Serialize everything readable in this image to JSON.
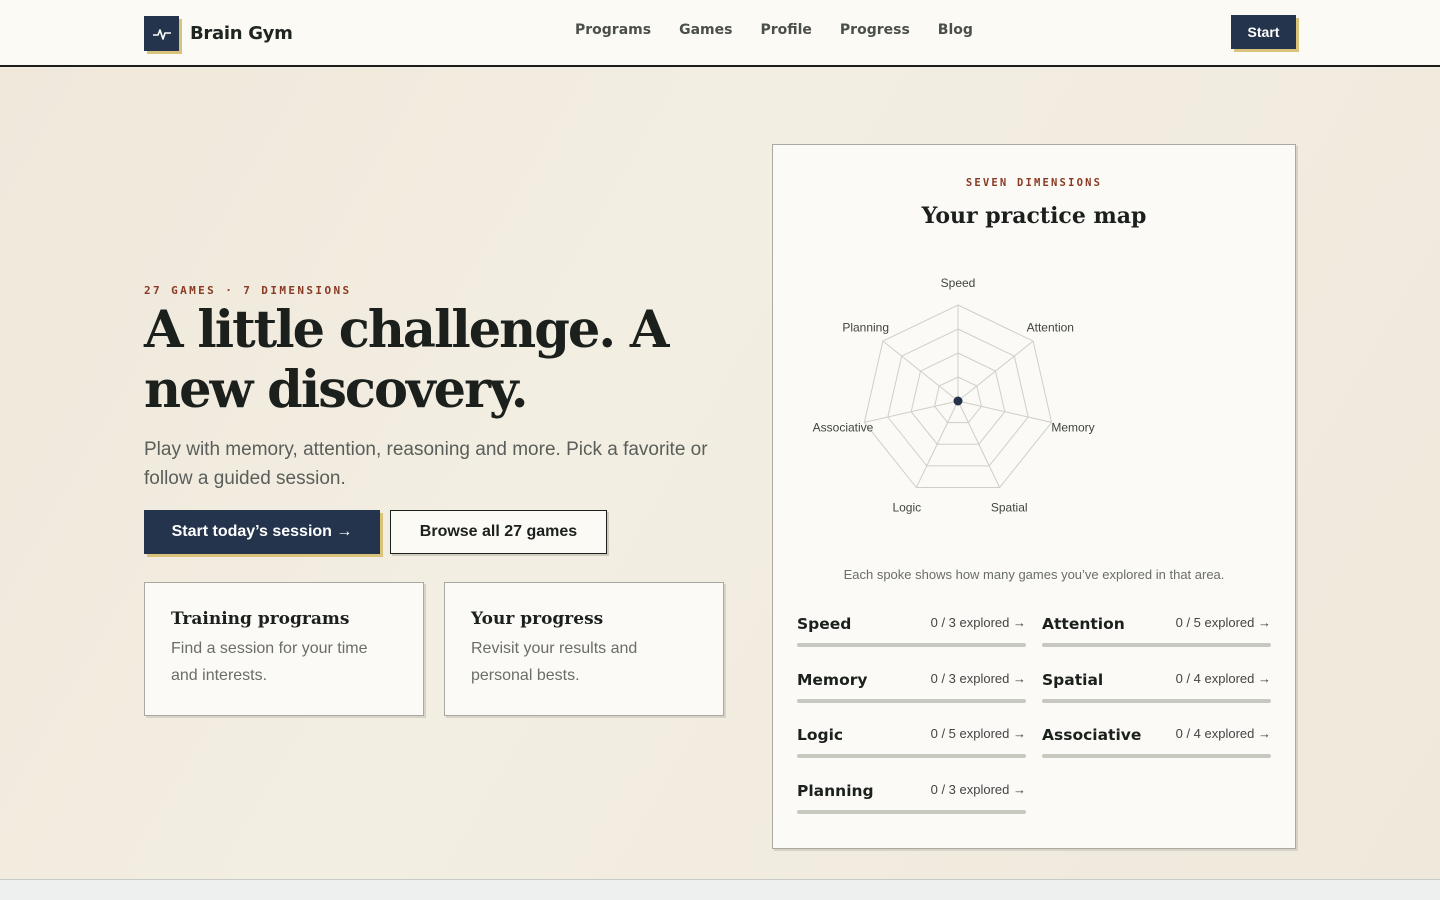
{
  "header": {
    "brand": "Brain Gym",
    "nav": [
      "Programs",
      "Games",
      "Profile",
      "Progress",
      "Blog"
    ],
    "start_label": "Start"
  },
  "hero": {
    "eyebrow": "27 GAMES · 7 DIMENSIONS",
    "headline": "A little challenge. A new discovery.",
    "lede": "Play with memory, attention, reasoning and more. Pick a favorite or follow a guided session.",
    "primary_cta": "Start today’s session →",
    "secondary_cta": "Browse all 27 games"
  },
  "cards": [
    {
      "title": "Training programs",
      "desc": "Find a session for your time and interests."
    },
    {
      "title": "Your progress",
      "desc": "Revisit your results and personal bests."
    }
  ],
  "practice_map": {
    "eyebrow": "SEVEN DIMENSIONS",
    "title": "Your practice map",
    "note": "Each spoke shows how many games you’ve explored in that area.",
    "dimensions": [
      {
        "name": "Speed",
        "explored": 0,
        "total": 3,
        "count_label": "0 / 3 explored →"
      },
      {
        "name": "Attention",
        "explored": 0,
        "total": 5,
        "count_label": "0 / 5 explored →"
      },
      {
        "name": "Memory",
        "explored": 0,
        "total": 3,
        "count_label": "0 / 3 explored →"
      },
      {
        "name": "Spatial",
        "explored": 0,
        "total": 4,
        "count_label": "0 / 4 explored →"
      },
      {
        "name": "Logic",
        "explored": 0,
        "total": 5,
        "count_label": "0 / 5 explored →"
      },
      {
        "name": "Associative",
        "explored": 0,
        "total": 4,
        "count_label": "0 / 4 explored →"
      },
      {
        "name": "Planning",
        "explored": 0,
        "total": 3,
        "count_label": "0 / 3 explored →"
      }
    ]
  },
  "colors": {
    "navy": "#24344c",
    "accent_gold": "#d9c27a",
    "eyebrow_rust": "#8a3a22"
  }
}
